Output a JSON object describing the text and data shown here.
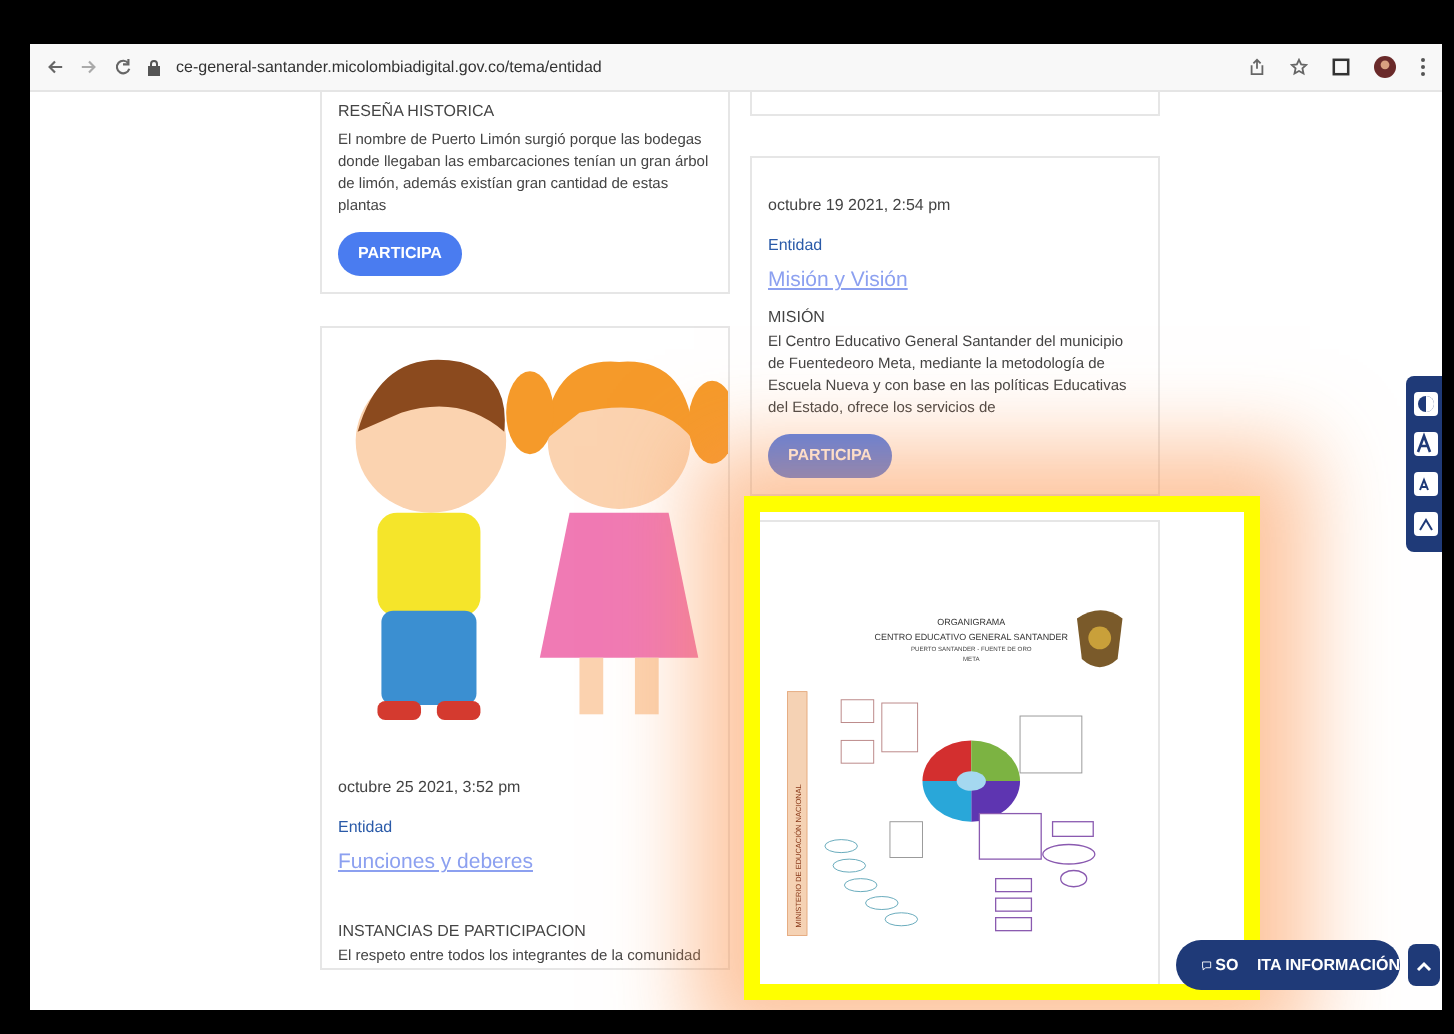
{
  "browser": {
    "url": "ce-general-santander.micolombiadigital.gov.co/tema/entidad"
  },
  "left_cards": [
    {
      "kind": "text",
      "heading": "RESEÑA HISTORICA",
      "body": "El nombre de Puerto Limón surgió porque las bodegas donde llegaban las embarcaciones tenían un gran árbol de limón, además existían gran cantidad de estas plantas",
      "button": "PARTICIPA"
    },
    {
      "date": "octubre 25 2021, 3:52 pm",
      "category": "Entidad",
      "link": "Funciones y deberes",
      "heading": "INSTANCIAS DE PARTICIPACION",
      "body": "El respeto entre todos los integrantes de la comunidad"
    }
  ],
  "right_cards": [
    {
      "kind": "stub"
    },
    {
      "kind": "post",
      "date": "octubre 19 2021, 2:54 pm",
      "category": "Entidad",
      "link": "Misión y Visión",
      "heading": "MISIÓN",
      "body": "El Centro Educativo General Santander del  municipio de Fuentedeoro  Meta, mediante la metodología  de Escuela Nueva y con base en las  políticas Educativas  del Estado, ofrece los servicios de",
      "button": "PARTICIPA"
    },
    {
      "kind": "chart",
      "title": "ORGANIGRAMA",
      "subtitle": "CENTRO EDUCATIVO GENERAL SANTANDER",
      "place": "PUERTO SANTANDER - FUENTE DE ORO",
      "region": "META",
      "side_label": "MINISTERIO DE EDUCACIÓN NACIONAL"
    }
  ],
  "contact_button": {
    "visible_start": "SO",
    "visible_end": "ITA INFORMACIÓN"
  }
}
